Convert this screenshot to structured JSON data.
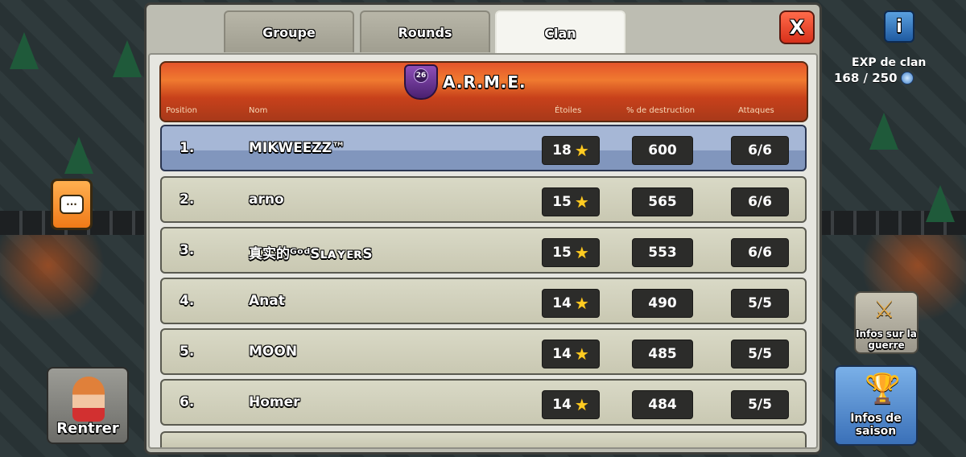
{
  "tabs": [
    {
      "label": "Groupe",
      "active": false
    },
    {
      "label": "Rounds",
      "active": false
    },
    {
      "label": "Clan",
      "active": true
    }
  ],
  "close_label": "X",
  "info_label": "i",
  "clan": {
    "name": "A.R.M.E.",
    "level": "26"
  },
  "columns": {
    "position": "Position",
    "name": "Nom",
    "stars": "Étoiles",
    "destruction": "% de destruction",
    "attacks": "Attaques"
  },
  "players": [
    {
      "position": "1.",
      "name": "MIKWEEZZ™",
      "stars": "18",
      "destruction": "600",
      "attacks": "6/6",
      "highlight": true
    },
    {
      "position": "2.",
      "name": "arno",
      "stars": "15",
      "destruction": "565",
      "attacks": "6/6"
    },
    {
      "position": "3.",
      "name": "真实的ᴳᵒᵈSʟᴀʏᴇʀS",
      "stars": "15",
      "destruction": "553",
      "attacks": "6/6"
    },
    {
      "position": "4.",
      "name": "Anat",
      "stars": "14",
      "destruction": "490",
      "attacks": "5/5"
    },
    {
      "position": "5.",
      "name": "MOON",
      "stars": "14",
      "destruction": "485",
      "attacks": "5/5"
    },
    {
      "position": "6.",
      "name": "Homer",
      "stars": "14",
      "destruction": "484",
      "attacks": "5/5"
    }
  ],
  "exp": {
    "label": "EXP de clan",
    "value": "168 / 250"
  },
  "buttons": {
    "home": "Rentrer",
    "war_info": "Infos sur la guerre",
    "season_info": "Infos de saison"
  },
  "colors": {
    "header": "#e4542a",
    "highlight_row": "#a6b7d6",
    "row": "#d9d9c6",
    "star": "#ffcc22",
    "close": "#d7301a"
  }
}
